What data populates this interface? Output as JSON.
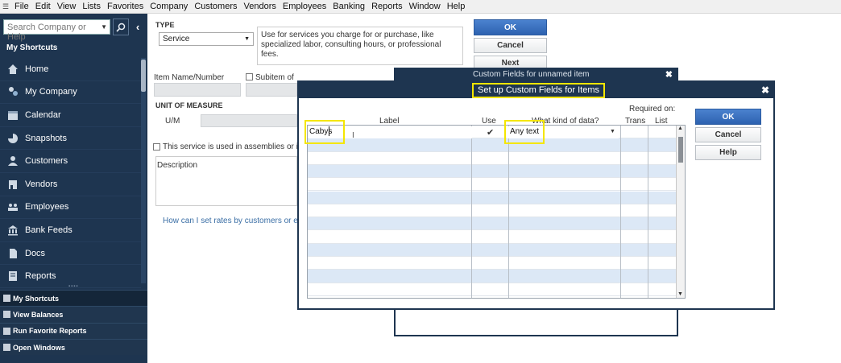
{
  "menu": [
    "File",
    "Edit",
    "View",
    "Lists",
    "Favorites",
    "Company",
    "Customers",
    "Vendors",
    "Employees",
    "Banking",
    "Reports",
    "Window",
    "Help"
  ],
  "menu_underline": [
    "F",
    "E",
    "V",
    "L",
    "",
    "C",
    "C",
    "n",
    "",
    "B",
    "R",
    "W",
    "H"
  ],
  "leftnav": {
    "search_placeholder": "Search Company or Help",
    "section_title": "My Shortcuts",
    "items": [
      {
        "label": "Home",
        "icon": "home-icon"
      },
      {
        "label": "My Company",
        "icon": "my-company-icon"
      },
      {
        "label": "Calendar",
        "icon": "calendar-icon"
      },
      {
        "label": "Snapshots",
        "icon": "snapshots-icon"
      },
      {
        "label": "Customers",
        "icon": "customers-icon"
      },
      {
        "label": "Vendors",
        "icon": "vendors-icon"
      },
      {
        "label": "Employees",
        "icon": "employees-icon"
      },
      {
        "label": "Bank Feeds",
        "icon": "bank-feeds-icon"
      },
      {
        "label": "Docs",
        "icon": "docs-icon"
      },
      {
        "label": "Reports",
        "icon": "reports-icon"
      }
    ],
    "bottom": [
      "My Shortcuts",
      "View Balances",
      "Run Favorite Reports",
      "Open Windows"
    ]
  },
  "form": {
    "type_label": "TYPE",
    "type_value": "Service",
    "type_desc": "Use for services you charge for or purchase, like specialized labor, consulting hours, or professional fees.",
    "item_name_label": "Item Name/Number",
    "subitem_label": "Subitem of",
    "uom_label": "UNIT OF MEASURE",
    "um_label": "U/M",
    "assembly_label": "This service is used in assemblies or is p",
    "description_label": "Description",
    "help_link": "How can I set rates by customers or emp",
    "ok": "OK",
    "cancel": "Cancel",
    "next": "Next"
  },
  "back_dialog": {
    "title": "Custom Fields for unnamed item"
  },
  "dialog": {
    "title": "Set up Custom Fields for Items",
    "required_on": "Required on:",
    "columns": {
      "label": "Label",
      "use": "Use",
      "kind": "What kind of data?",
      "trans": "Trans",
      "list": "List"
    },
    "row1": {
      "label": "Cabys",
      "use": "✔",
      "kind": "Any text"
    },
    "ok": "OK",
    "cancel": "Cancel",
    "help": "Help"
  },
  "colors": {
    "nav": "#1e3550",
    "highlight": "#f4e600",
    "row_alt": "#dce8f6",
    "primary_btn": "#2d62b0"
  }
}
